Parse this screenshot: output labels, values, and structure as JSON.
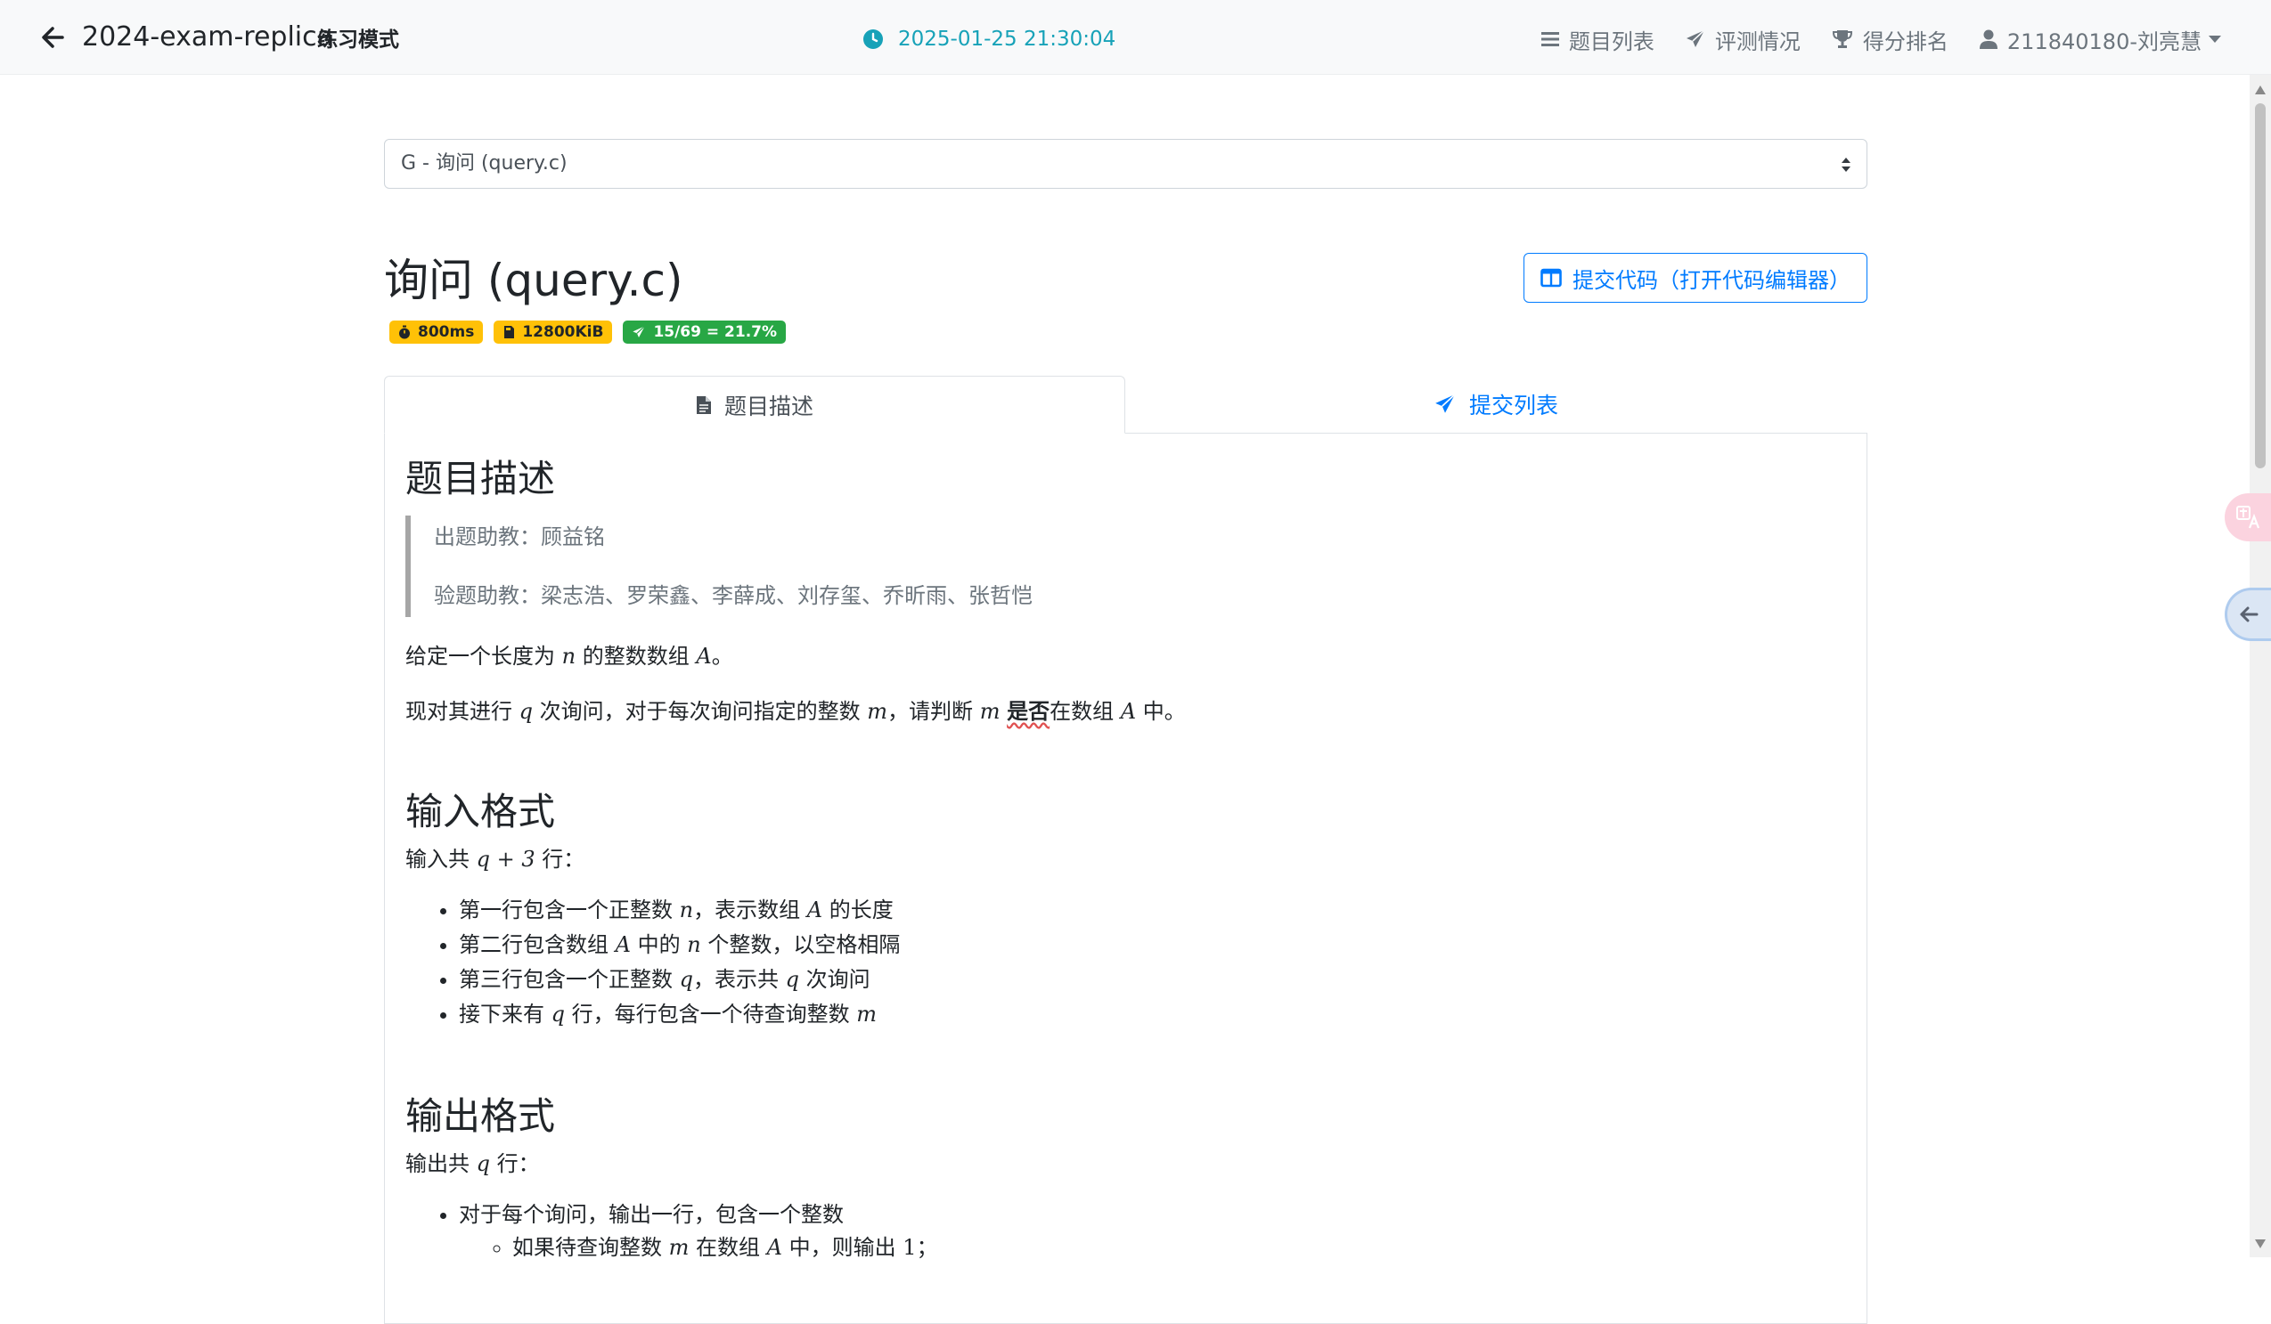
{
  "navbar": {
    "title": "2024-exam-replica",
    "mode": "练习模式",
    "clock": "2025-01-25 21:30:04",
    "menu": {
      "problems": "题目列表",
      "judging": "评测情况",
      "ranking": "得分排名",
      "user": "211840180-刘亮慧"
    }
  },
  "problem_select": {
    "selected": "G - 询问 (query.c)"
  },
  "problem": {
    "title": "询问 (query.c)",
    "time_limit": "800ms",
    "memory_limit": "12800KiB",
    "pass_rate": "15/69 = 21.7%",
    "submit_label": "提交代码（打开代码编辑器）"
  },
  "tabs": {
    "description": "题目描述",
    "submissions": "提交列表"
  },
  "content": {
    "desc_heading": "题目描述",
    "author": "出题助教：顾益铭",
    "testers": "验题助教：梁志浩、罗荣鑫、李薛成、刘存玺、乔昕雨、张哲恺",
    "para1": {
      "a": "给定一个长度为 ",
      "n": "n",
      "b": " 的整数数组 ",
      "A": "A",
      "c": "。"
    },
    "para2": {
      "a": "现对其进行 ",
      "q": "q",
      "b": " 次询问，对于每次询问指定的整数 ",
      "m": "m",
      "c": "，请判断 ",
      "m2": "m",
      "d": " ",
      "bold": "是否",
      "e": "在数组 ",
      "A": "A",
      "f": " 中。"
    },
    "input_heading": "输入格式",
    "input_intro": {
      "a": "输入共 ",
      "expr": "q + 3",
      "b": " 行："
    },
    "input_items": [
      {
        "a": "第一行包含一个正整数 ",
        "v1": "n",
        "b": "，表示数组 ",
        "v2": "A",
        "c": " 的长度"
      },
      {
        "a": "第二行包含数组 ",
        "v1": "A",
        "b": " 中的 ",
        "v2": "n",
        "c": " 个整数，以空格相隔"
      },
      {
        "a": "第三行包含一个正整数 ",
        "v1": "q",
        "b": "，表示共 ",
        "v2": "q",
        "c": " 次询问"
      },
      {
        "a": "接下来有 ",
        "v1": "q",
        "b": " 行，每行包含一个待查询整数 ",
        "v2": "m",
        "c": ""
      }
    ],
    "output_heading": "输出格式",
    "output_intro": {
      "a": "输出共 ",
      "q": "q",
      "b": " 行："
    },
    "output_item": "对于每个询问，输出一行，包含一个整数",
    "output_sub": {
      "a": "如果待查询整数 ",
      "m": "m",
      "b": " 在数组 ",
      "A": "A",
      "c": " 中，则输出 ",
      "one": "1",
      "d": "；"
    }
  },
  "colors": {
    "primary": "#007bff",
    "info": "#17a2b8",
    "warning": "#ffc107",
    "success": "#28a745"
  }
}
